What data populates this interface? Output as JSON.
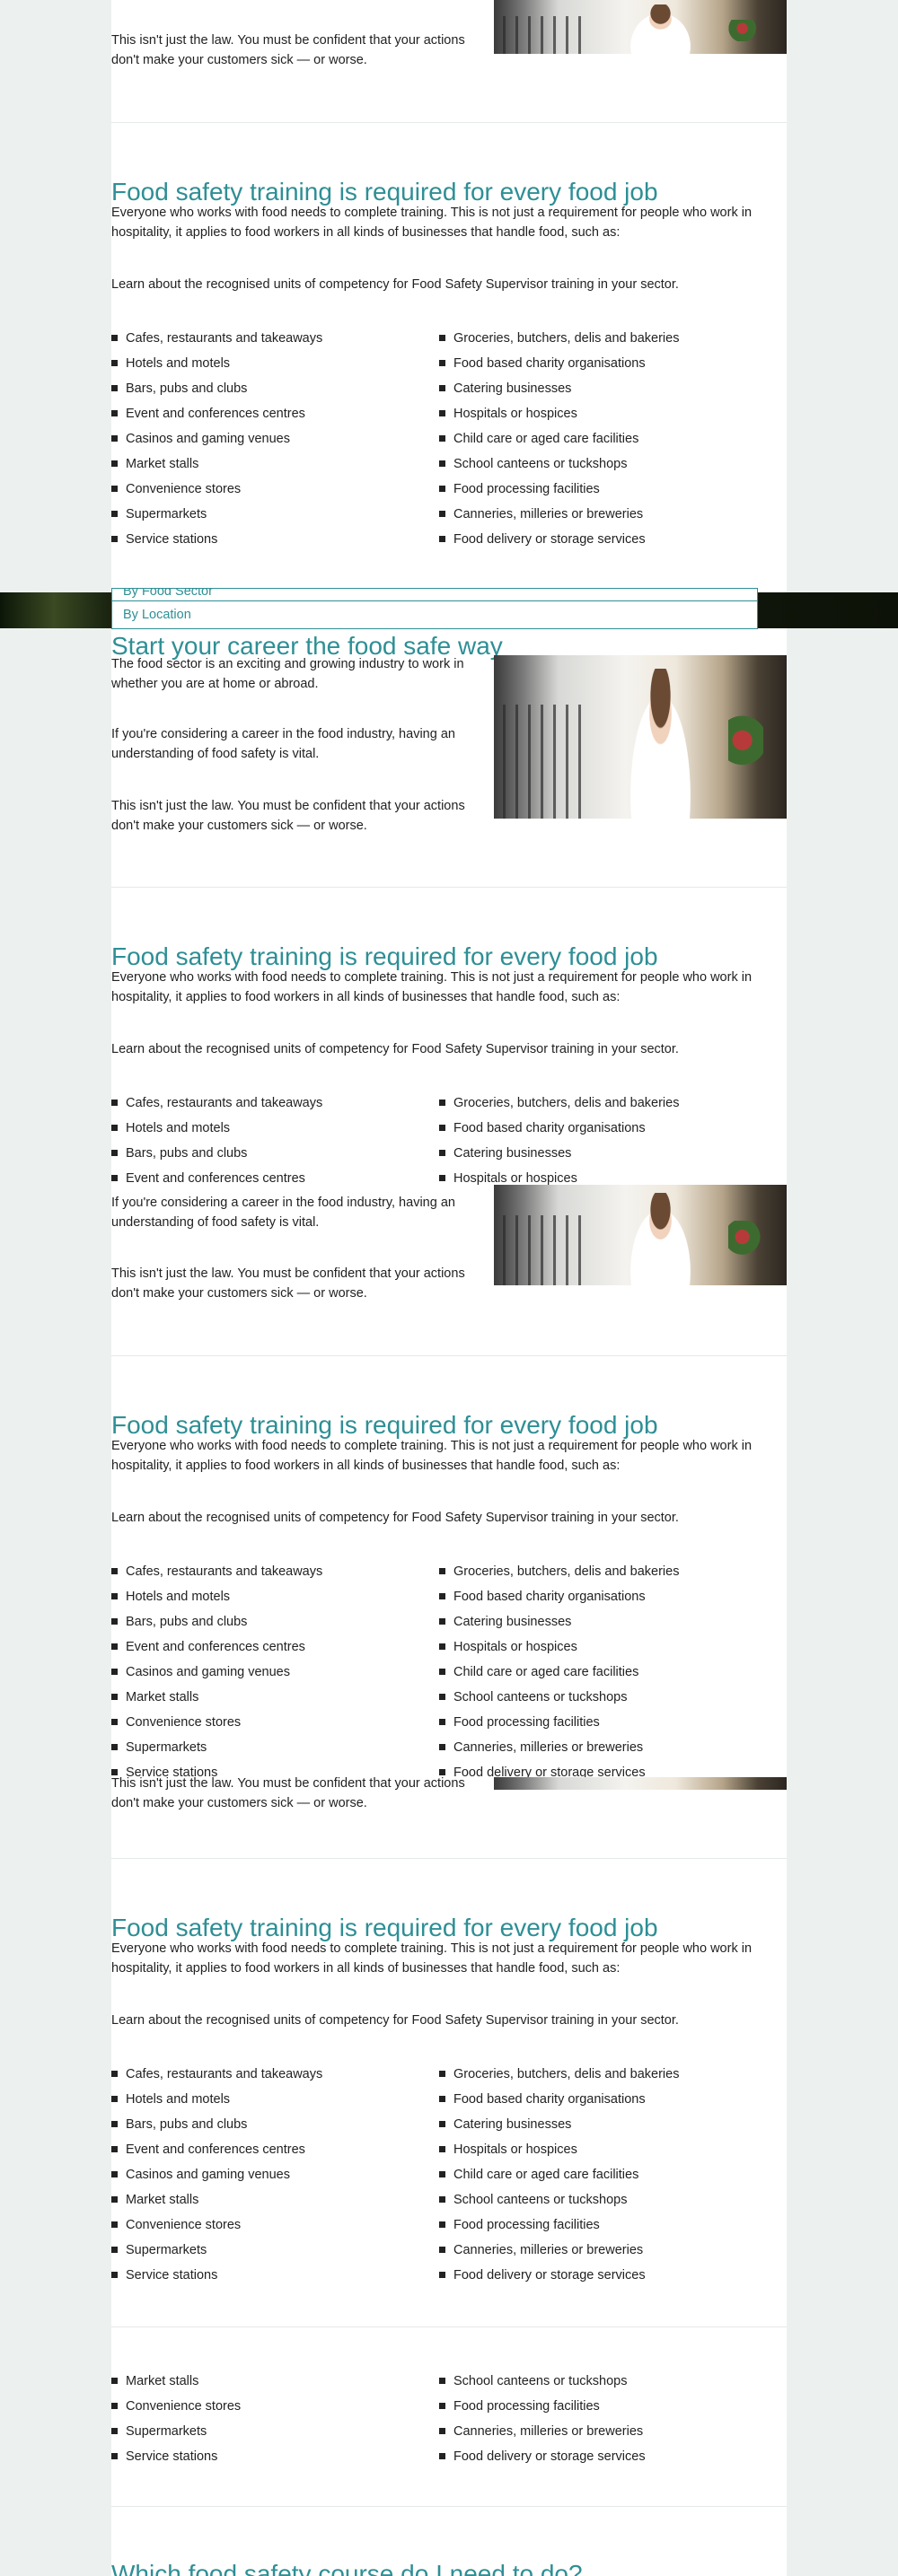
{
  "intro": {
    "title": "Start your career the food safe way",
    "p1": "The food sector is an exciting and growing industry to work in whether you are at home or abroad.",
    "p2": "If you're considering a career in the food industry, having an understanding of food safety is vital.",
    "p3": "This isn't just the law. You must be confident that your actions don't make your customers sick — or worse."
  },
  "training": {
    "title": "Food safety training is required for every food job",
    "p1": "Everyone who works with food needs to complete training. This is not just a requirement for people who work in hospitality, it applies to food workers in all kinds of businesses that handle food, such as:",
    "p2": "Learn about the recognised units of competency for Food Safety Supervisor training in your sector.",
    "left_items": [
      "Cafes, restaurants and takeaways",
      "Hotels and motels",
      "Bars, pubs and clubs",
      "Event and conferences centres",
      "Casinos and gaming venues",
      "Market stalls",
      "Convenience stores",
      "Supermarkets",
      "Service stations"
    ],
    "right_items": [
      "Groceries, butchers, delis and bakeries",
      "Food based charity organisations",
      "Catering businesses",
      "Hospitals or hospices",
      "Child care or aged care facilities",
      "School canteens or tuckshops",
      "Food processing facilities",
      "Canneries, milleries or breweries",
      "Food delivery or storage services"
    ]
  },
  "dropdown": {
    "by_sector": "By Food Sector",
    "by_location": "By Location"
  },
  "next_title": "Which food safety course do I need to do?"
}
